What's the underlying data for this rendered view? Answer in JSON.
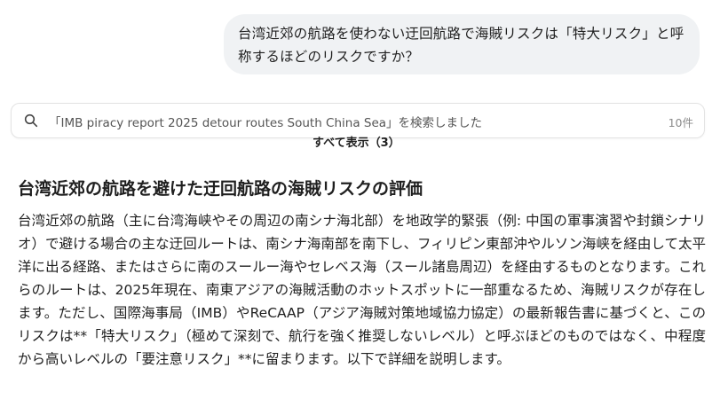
{
  "user_message": {
    "text": "台湾近郊の航路を使わない迂回航路で海賊リスクは「特大リスク」と呼称するほどのリスクですか？"
  },
  "search": {
    "query_text": "「IMB piracy report 2025 detour routes South China Sea」を検索しました",
    "count": "10件",
    "show_all": "すべて表示（3）"
  },
  "answer": {
    "heading": "台湾近郊の航路を避けた迂回航路の海賊リスクの評価",
    "paragraph": "台湾近郊の航路（主に台湾海峡やその周辺の南シナ海北部）を地政学的緊張（例: 中国の軍事演習や封鎖シナリオ）で避ける場合の主な迂回ルートは、南シナ海南部を南下し、フィリピン東部沖やルソン海峡を経由して太平洋に出る経路、またはさらに南のスールー海やセレベス海（スール諸島周辺）を経由するものとなります。これらのルートは、2025年現在、南東アジアの海賊活動のホットスポットに一部重なるため、海賊リスクが存在します。ただし、国際海事局（IMB）やReCAAP（アジア海賊対策地域協力協定）の最新報告書に基づくと、このリスクは**「特大リスク」（極めて深刻で、航行を強く推奨しないレベル）と呼ぶほどのものではなく、中程度から高いレベルの「要注意リスク」**に留まります。以下で詳細を説明します。"
  }
}
